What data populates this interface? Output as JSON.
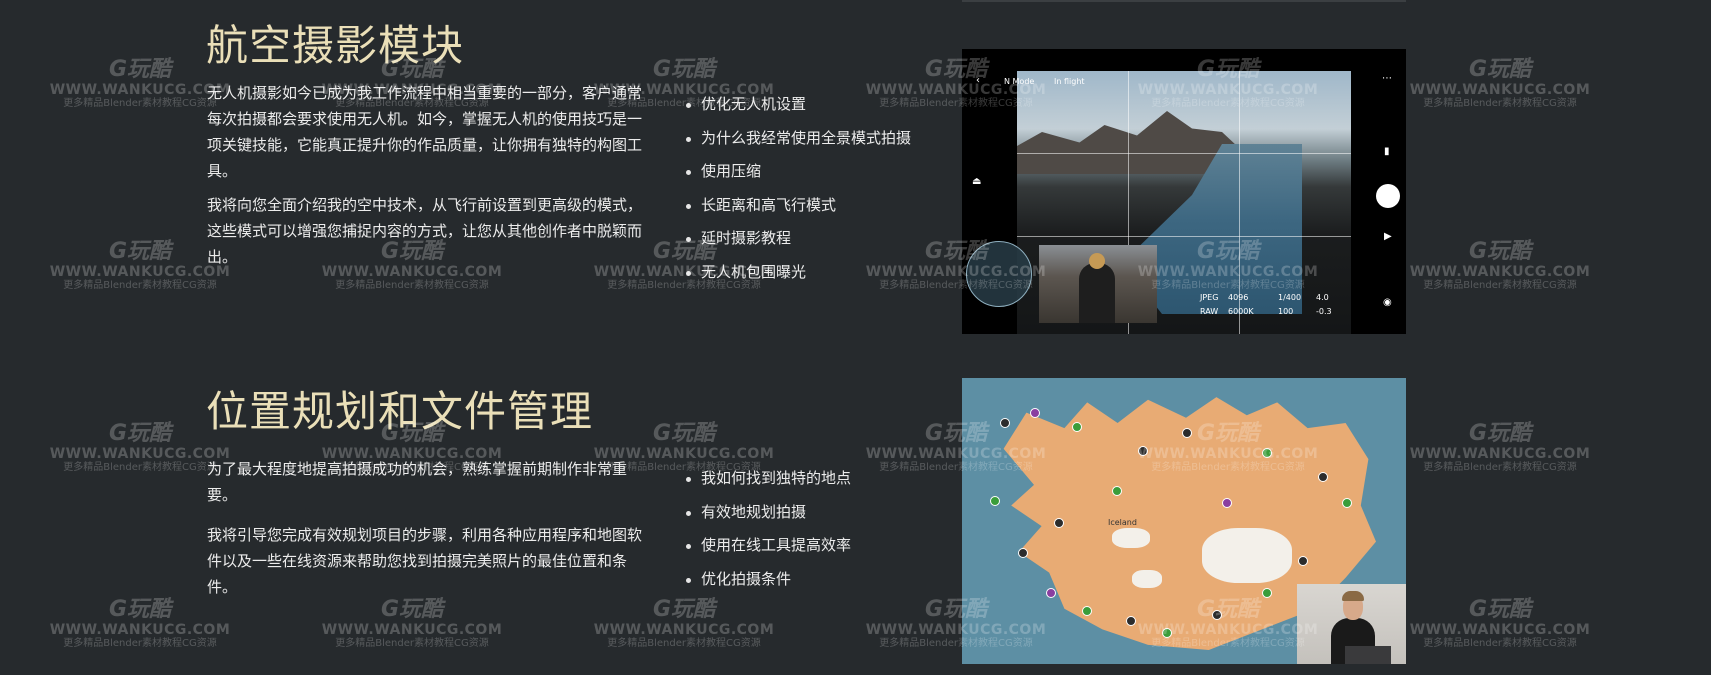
{
  "section1": {
    "title": "航空摄影模块",
    "paragraphs": [
      "无人机摄影如今已成为我工作流程中相当重要的一部分，客户通常每次拍摄都会要求使用无人机。如今，掌握无人机的使用技巧是一项关键技能，它能真正提升你的作品质量，让你拥有独特的构图工具。",
      "我将向您全面介绍我的空中技术，从飞行前设置到更高级的模式，这些模式可以增强您捕捉内容的方式，让您从其他创作者中脱颖而出。"
    ],
    "bullets": [
      "优化无人机设置",
      "为什么我经常使用全景模式拍摄",
      "使用压缩",
      "长距离和高飞行模式",
      "延时摄影教程",
      "无人机包围曝光"
    ],
    "drone_hud": {
      "mode": "N Mode",
      "status": "In flight",
      "format": "JPEG",
      "raw": "RAW",
      "shutter": "1/400",
      "wb": "6000K",
      "iso": "100",
      "aperture": "4.0",
      "ev": "-0.3",
      "res": "4096"
    }
  },
  "section2": {
    "title": "位置规划和文件管理",
    "paragraphs": [
      "为了最大程度地提高拍摄成功的机会，熟练掌握前期制作非常重要。",
      "我将引导您完成有效规划项目的步骤，利用各种应用程序和地图软件以及一些在线资源来帮助您找到拍摄完美照片的最佳位置和条件。"
    ],
    "bullets": [
      "我如何找到独特的地点",
      "有效地规划拍摄",
      "使用在线工具提高效率",
      "优化拍摄条件"
    ],
    "map_label": "Iceland"
  },
  "watermark": {
    "logo": "G玩酷",
    "site": "WWW.WANKUCG.COM",
    "sub": "更多精品Blender素材教程CG资源"
  }
}
